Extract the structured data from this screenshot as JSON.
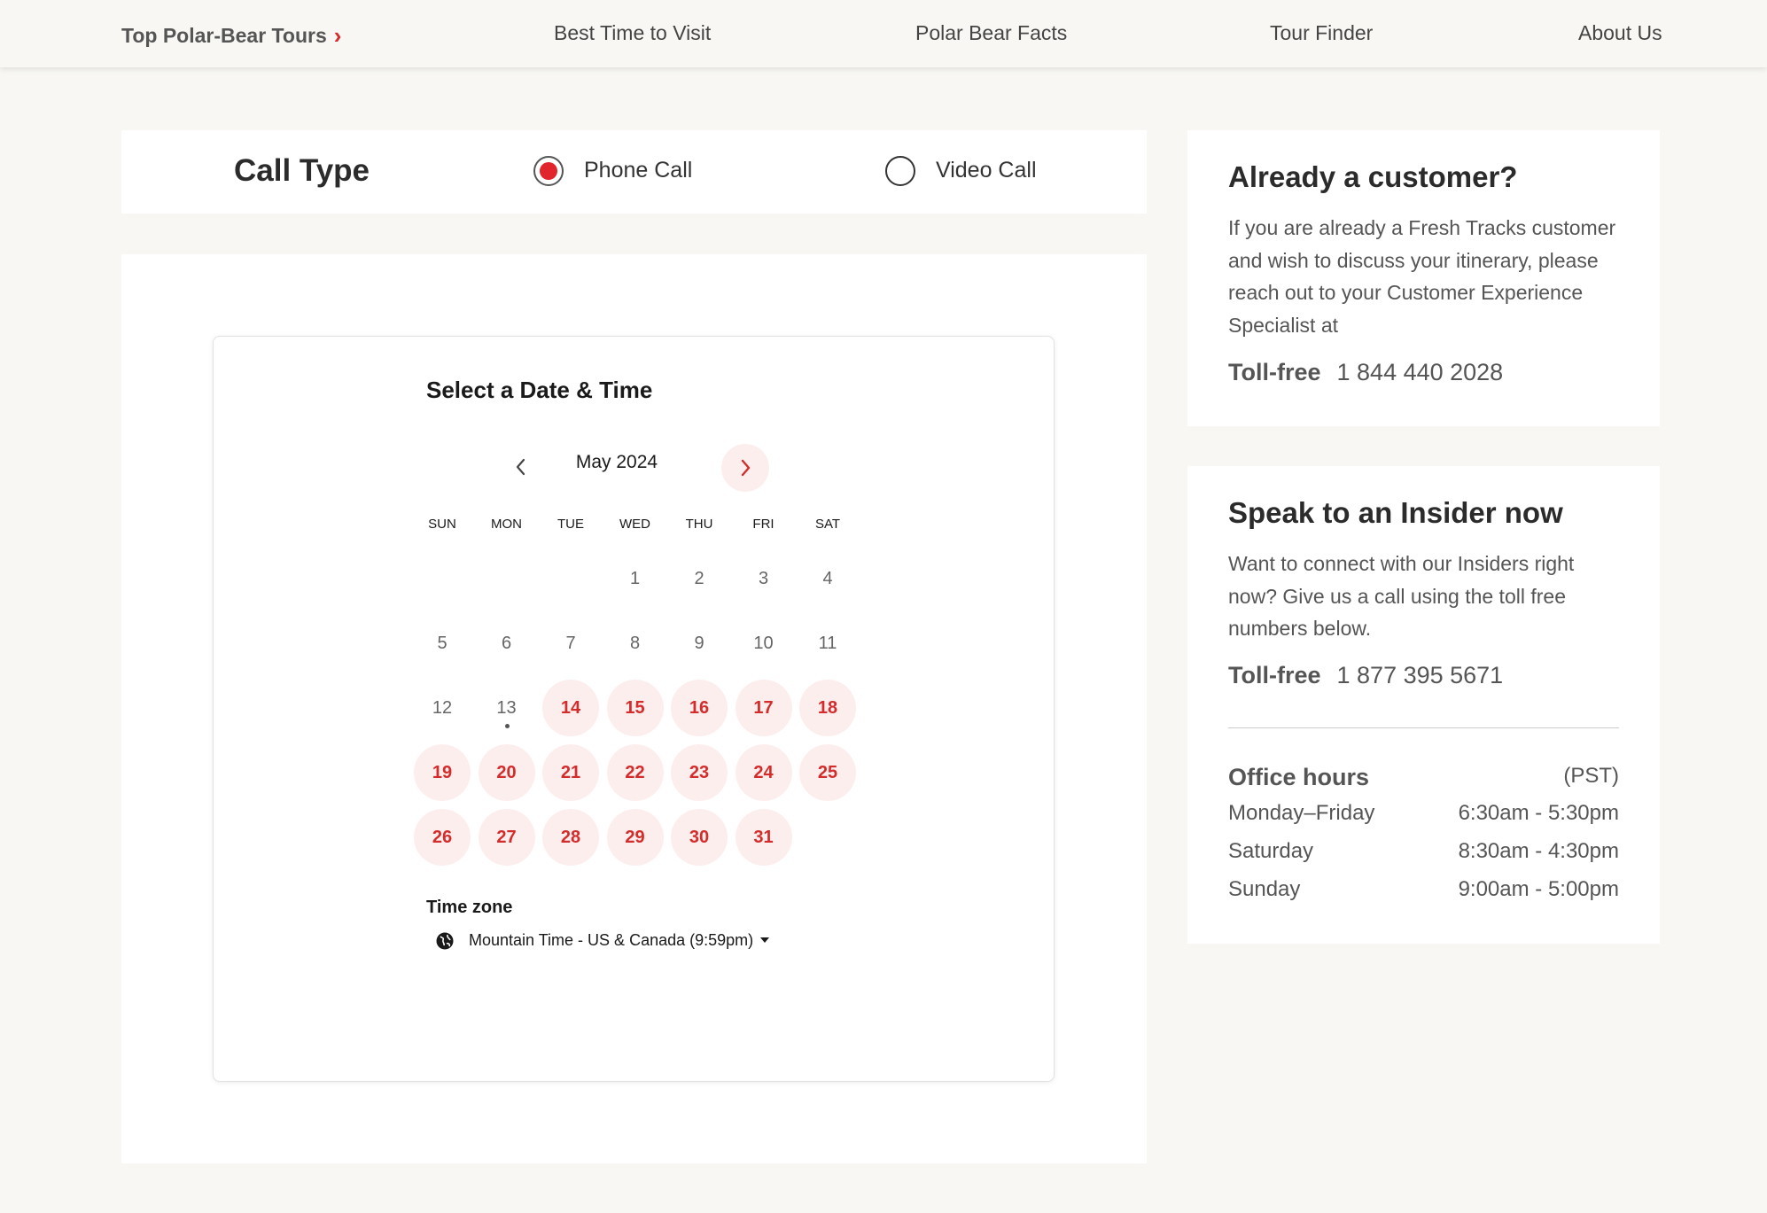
{
  "nav": {
    "items": [
      {
        "label": "Top Polar-Bear Tours",
        "active": true
      },
      {
        "label": "Best Time to Visit"
      },
      {
        "label": "Polar Bear Facts"
      },
      {
        "label": "Tour Finder"
      },
      {
        "label": "About Us"
      }
    ]
  },
  "call_type": {
    "title": "Call Type",
    "options": [
      {
        "label": "Phone Call",
        "selected": true
      },
      {
        "label": "Video Call",
        "selected": false
      }
    ]
  },
  "scheduler": {
    "title": "Select a Date & Time",
    "month": "May 2024",
    "weekdays": [
      "SUN",
      "MON",
      "TUE",
      "WED",
      "THU",
      "FRI",
      "SAT"
    ],
    "first_weekday_index": 3,
    "days_in_month": 31,
    "today": 13,
    "available_days": [
      14,
      15,
      16,
      17,
      18,
      19,
      20,
      21,
      22,
      23,
      24,
      25,
      26,
      27,
      28,
      29,
      30,
      31
    ],
    "timezone_label": "Time zone",
    "timezone_value": "Mountain Time - US & Canada (9:59pm)"
  },
  "customer_card": {
    "title": "Already a customer?",
    "body": "If you are already a Fresh Tracks customer and wish to discuss your itinerary, please reach out to your Customer Experience Specialist at",
    "tollfree_label": "Toll-free",
    "tollfree_number": "1 844 440 2028"
  },
  "insider_card": {
    "title": "Speak to an Insider now",
    "body": "Want to connect with our Insiders right now? Give us a call using the toll free numbers below.",
    "tollfree_label": "Toll-free",
    "tollfree_number": "1 877 395 5671",
    "hours_title": "Office hours",
    "hours_tz": "(PST)",
    "hours": [
      {
        "day": "Monday–Friday",
        "time": "6:30am - 5:30pm"
      },
      {
        "day": "Saturday",
        "time": "8:30am - 4:30pm"
      },
      {
        "day": "Sunday",
        "time": "9:00am - 5:00pm"
      }
    ]
  },
  "colors": {
    "accent": "#d42b2b",
    "accent_soft": "#fdeeee",
    "background": "#f8f7f4"
  }
}
